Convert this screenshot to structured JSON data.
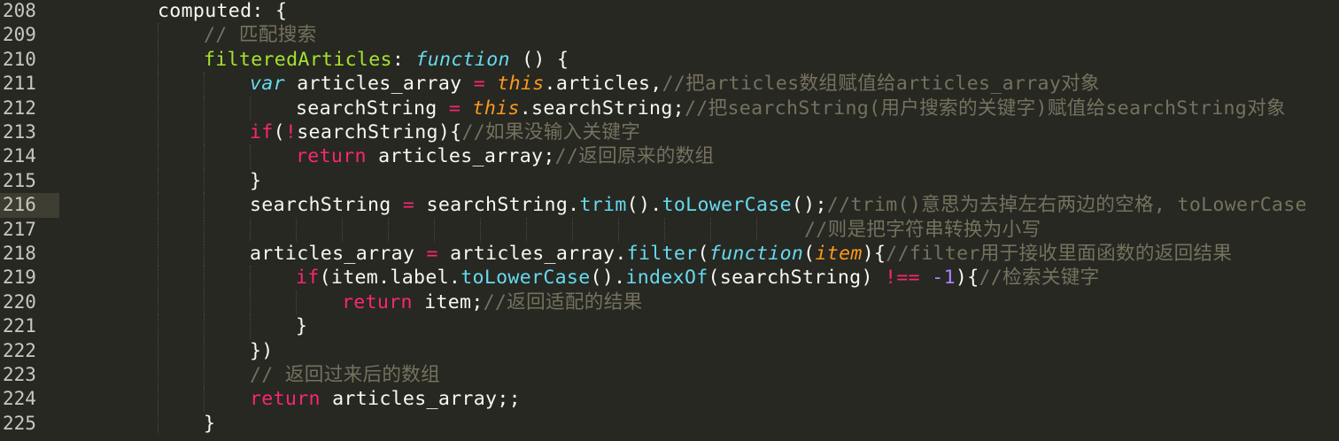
{
  "editor": {
    "theme": "monokai",
    "active_line": "216",
    "lines": [
      {
        "num": "208",
        "tokens": [
          [
            "plain",
            "computed: {"
          ]
        ]
      },
      {
        "num": "209",
        "tokens": [
          [
            "cmt",
            "// 匹配搜索"
          ]
        ]
      },
      {
        "num": "210",
        "tokens": [
          [
            "fn",
            "filteredArticles"
          ],
          [
            "plain",
            ": "
          ],
          [
            "kw-italic",
            "function"
          ],
          [
            "plain",
            " () {"
          ]
        ]
      },
      {
        "num": "211",
        "tokens": [
          [
            "kw-italic",
            "var"
          ],
          [
            "plain",
            " articles_array "
          ],
          [
            "op",
            "="
          ],
          [
            "plain",
            " "
          ],
          [
            "kw-this",
            "this"
          ],
          [
            "plain",
            ".articles,"
          ],
          [
            "cmt",
            "//把articles数组赋值给articles_array对象"
          ]
        ]
      },
      {
        "num": "212",
        "tokens": [
          [
            "plain",
            "searchString "
          ],
          [
            "op",
            "="
          ],
          [
            "plain",
            " "
          ],
          [
            "kw-this",
            "this"
          ],
          [
            "plain",
            ".searchString;"
          ],
          [
            "cmt",
            "//把searchString(用户搜索的关键字)赋值给searchString对象"
          ]
        ]
      },
      {
        "num": "213",
        "tokens": [
          [
            "kw-red",
            "if"
          ],
          [
            "plain",
            "("
          ],
          [
            "op",
            "!"
          ],
          [
            "plain",
            "searchString){"
          ],
          [
            "cmt",
            "//如果没输入关键字"
          ]
        ]
      },
      {
        "num": "214",
        "tokens": [
          [
            "kw-red",
            "return"
          ],
          [
            "plain",
            " articles_array;"
          ],
          [
            "cmt",
            "//返回原来的数组"
          ]
        ]
      },
      {
        "num": "215",
        "tokens": [
          [
            "plain",
            "}"
          ]
        ]
      },
      {
        "num": "216",
        "tokens": [
          [
            "plain",
            "searchString "
          ],
          [
            "op",
            "="
          ],
          [
            "plain",
            " searchString."
          ],
          [
            "method",
            "trim"
          ],
          [
            "plain",
            "()."
          ],
          [
            "method",
            "toLowerCase"
          ],
          [
            "plain",
            "();"
          ],
          [
            "cmt",
            "//trim()意思为去掉左右两边的空格, toLowerCase"
          ]
        ]
      },
      {
        "num": "217",
        "tokens": [
          [
            "cmt",
            "//则是把字符串转换为小写"
          ]
        ]
      },
      {
        "num": "218",
        "tokens": [
          [
            "plain",
            "articles_array "
          ],
          [
            "op",
            "="
          ],
          [
            "plain",
            " articles_array."
          ],
          [
            "method",
            "filter"
          ],
          [
            "plain",
            "("
          ],
          [
            "kw-italic",
            "function"
          ],
          [
            "plain",
            "("
          ],
          [
            "param",
            "item"
          ],
          [
            "plain",
            "){"
          ],
          [
            "cmt",
            "//filter用于接收里面函数的返回结果"
          ]
        ]
      },
      {
        "num": "219",
        "tokens": [
          [
            "kw-red",
            "if"
          ],
          [
            "plain",
            "(item.label."
          ],
          [
            "method",
            "toLowerCase"
          ],
          [
            "plain",
            "()."
          ],
          [
            "method",
            "indexOf"
          ],
          [
            "plain",
            "(searchString) "
          ],
          [
            "op",
            "!=="
          ],
          [
            "plain",
            " "
          ],
          [
            "num",
            "-1"
          ],
          [
            "plain",
            "){"
          ],
          [
            "cmt",
            "//检索关键字"
          ]
        ]
      },
      {
        "num": "220",
        "tokens": [
          [
            "kw-red",
            "return"
          ],
          [
            "plain",
            " item;"
          ],
          [
            "cmt",
            "//返回适配的结果"
          ]
        ]
      },
      {
        "num": "221",
        "tokens": [
          [
            "plain",
            "}"
          ]
        ]
      },
      {
        "num": "222",
        "tokens": [
          [
            "plain",
            "})"
          ]
        ]
      },
      {
        "num": "223",
        "tokens": [
          [
            "cmt",
            "// 返回过来后的数组"
          ]
        ]
      },
      {
        "num": "224",
        "tokens": [
          [
            "kw-red",
            "return"
          ],
          [
            "plain",
            " articles_array;;"
          ]
        ]
      },
      {
        "num": "225",
        "tokens": [
          [
            "plain",
            "}"
          ]
        ]
      }
    ]
  }
}
